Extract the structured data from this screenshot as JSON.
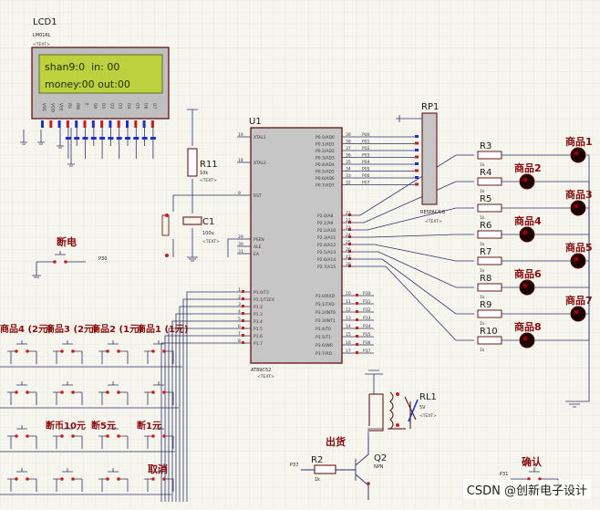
{
  "colors": {
    "wire": "#2b2f6b",
    "chip_fill": "#c6c6c6",
    "chip_stroke": "#5a0000",
    "lcd_bg": "#bdd13f",
    "lcd_text": "#1c2b08",
    "pin_blue": "#1d2fd0",
    "pin_red": "#d01a1a",
    "led_red": "#a00000",
    "grid": "#dcdcd0",
    "label_red": "#8b0a0a"
  },
  "lcd": {
    "ref": "LCD1",
    "model": "LM016L",
    "text_tag": "<TEXT>",
    "line1": "shan9:0  in: 00",
    "line2": "money:00 out:00",
    "pins": [
      "VSS",
      "VDD",
      "VEE",
      "RS",
      "RW",
      "E",
      "D0",
      "D1",
      "D2",
      "D3",
      "D4",
      "D5",
      "D6",
      "D7"
    ]
  },
  "mcu": {
    "ref": "U1",
    "model": "AT89C52",
    "text_tag": "<TEXT>",
    "left_pins": [
      {
        "n": "19",
        "name": "XTAL1"
      },
      {
        "n": "18",
        "name": "XTAL2"
      },
      {
        "n": "9",
        "name": "RST"
      },
      {
        "n": "29",
        "name": "PSEN"
      },
      {
        "n": "30",
        "name": "ALE"
      },
      {
        "n": "31",
        "name": "EA"
      },
      {
        "n": "1",
        "name": "P1.0/T2"
      },
      {
        "n": "2",
        "name": "P1.1/T2EX"
      },
      {
        "n": "3",
        "name": "P1.2"
      },
      {
        "n": "4",
        "name": "P1.3"
      },
      {
        "n": "5",
        "name": "P1.4"
      },
      {
        "n": "6",
        "name": "P1.5"
      },
      {
        "n": "7",
        "name": "P1.6"
      },
      {
        "n": "8",
        "name": "P1.7"
      }
    ],
    "p0_pins": [
      {
        "n": "39",
        "name": "P0.0/AD0",
        "net": "P00"
      },
      {
        "n": "38",
        "name": "P0.1/AD1",
        "net": "P01"
      },
      {
        "n": "37",
        "name": "P0.2/AD2",
        "net": "P02"
      },
      {
        "n": "36",
        "name": "P0.3/AD3",
        "net": "P03"
      },
      {
        "n": "35",
        "name": "P0.4/AD4",
        "net": "P04"
      },
      {
        "n": "34",
        "name": "P0.5/AD5",
        "net": "P05"
      },
      {
        "n": "33",
        "name": "P0.6/AD6",
        "net": "P06"
      },
      {
        "n": "32",
        "name": "P0.7/AD7",
        "net": "P07"
      }
    ],
    "p2_pins": [
      {
        "n": "21",
        "name": "P2.0/A8"
      },
      {
        "n": "22",
        "name": "P2.1/A9"
      },
      {
        "n": "23",
        "name": "P2.2/A10"
      },
      {
        "n": "24",
        "name": "P2.3/A11"
      },
      {
        "n": "25",
        "name": "P2.4/A12"
      },
      {
        "n": "26",
        "name": "P2.5/A13"
      },
      {
        "n": "27",
        "name": "P2.6/A14"
      },
      {
        "n": "28",
        "name": "P2.7/A15"
      }
    ],
    "p3_pins": [
      {
        "n": "10",
        "name": "P3.0/RXD",
        "net": "P30"
      },
      {
        "n": "11",
        "name": "P3.1/TXD",
        "net": "P31"
      },
      {
        "n": "12",
        "name": "P3.2/INT0",
        "net": "P32"
      },
      {
        "n": "13",
        "name": "P3.3/INT1",
        "net": "P33"
      },
      {
        "n": "14",
        "name": "P3.4/T0",
        "net": "P34"
      },
      {
        "n": "15",
        "name": "P3.5/T1",
        "net": "P35"
      },
      {
        "n": "16",
        "name": "P3.6/WR",
        "net": "P36"
      },
      {
        "n": "17",
        "name": "P3.7/RD",
        "net": "P37"
      }
    ]
  },
  "rp1": {
    "ref": "RP1",
    "model": "RESPACK-8",
    "text_tag": "<TEXT>"
  },
  "r11": {
    "ref": "R11",
    "value": "10k",
    "text_tag": "<TEXT>"
  },
  "c1": {
    "ref": "C1",
    "value": "100u",
    "text_tag": "<TEXT>"
  },
  "reset_button": {
    "label": "断电",
    "net": "P30"
  },
  "leds": [
    {
      "label": "商品1",
      "res": "R3",
      "res_val": "1k"
    },
    {
      "label": "商品2",
      "res": "R4",
      "res_val": "1k"
    },
    {
      "label": "商品3",
      "res": "R5",
      "res_val": "1k"
    },
    {
      "label": "商品4",
      "res": "R6",
      "res_val": "1k"
    },
    {
      "label": "商品5",
      "res": "R7",
      "res_val": "1k"
    },
    {
      "label": "商品6",
      "res": "R8",
      "res_val": "1k"
    },
    {
      "label": "商品7",
      "res": "R9",
      "res_val": "1k"
    },
    {
      "label": "商品8",
      "res": "R10",
      "res_val": "1k"
    }
  ],
  "keypad": {
    "row1": [
      "商品4 (2元)",
      "商品3 (2元)",
      "商品2 (1元)",
      "商品1 (1元)"
    ],
    "row3": [
      "断币10元",
      "断5元",
      "断1元"
    ],
    "row4_label": "取消"
  },
  "relay": {
    "ref": "RL1",
    "value": "5V",
    "text_tag": "<TEXT>"
  },
  "output": {
    "label": "出货",
    "r2": "R2",
    "r2_val": "1k",
    "q2": "Q2",
    "q2_type": "NPN",
    "net": "P37"
  },
  "confirm": {
    "label": "确认",
    "net": "P31"
  },
  "watermark": "CSDN @创新电子设计"
}
